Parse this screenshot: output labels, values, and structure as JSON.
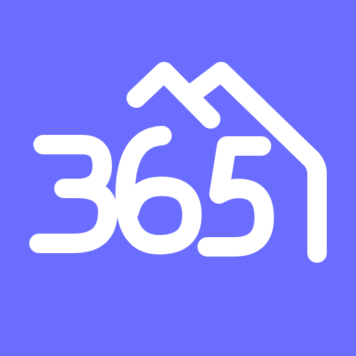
{
  "logo": {
    "text": "365",
    "icon": "house-roof-mountains-icon"
  },
  "colors": {
    "background": "#6b6dff",
    "foreground": "#ffffff"
  }
}
